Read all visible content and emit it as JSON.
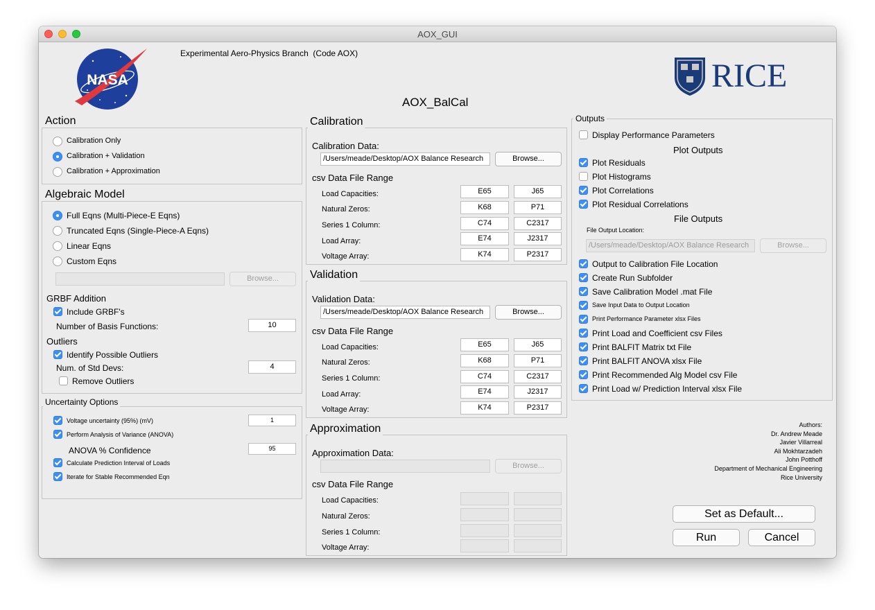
{
  "window": {
    "title": "AOX_GUI"
  },
  "header": {
    "branch": "Experimental Aero-Physics Branch  (Code AOX)",
    "app_name": "AOX_BalCal",
    "nasa_logo_text": "NASA",
    "rice_logo_text": "RICE"
  },
  "action": {
    "title": "Action",
    "options": [
      "Calibration Only",
      "Calibration + Validation",
      "Calibration + Approximation"
    ],
    "selected": "Calibration + Validation"
  },
  "algebraic_model": {
    "title": "Algebraic Model",
    "options": [
      "Full Eqns (Multi-Piece-E Eqns)",
      "Truncated Eqns (Single-Piece-A Eqns)",
      "Linear Eqns",
      "Custom Eqns"
    ],
    "selected": "Full Eqns (Multi-Piece-E Eqns)",
    "custom_path": "",
    "browse_label": "Browse...",
    "grbf": {
      "title": "GRBF Addition",
      "include_label": "Include GRBF's",
      "include_checked": true,
      "basis_label": "Number of Basis Functions:",
      "basis_value": "10"
    },
    "outliers": {
      "title": "Outliers",
      "identify_label": "Identify Possible Outliers",
      "identify_checked": true,
      "std_label": "Num. of Std Devs:",
      "std_value": "4",
      "remove_label": "Remove Outliers",
      "remove_checked": false
    }
  },
  "uncertainty": {
    "title": "Uncertainty Options",
    "voltage_label": "Voltage uncertainty (95%) (mV)",
    "voltage_value": "1",
    "anova_label": "Perform Analysis of Variance (ANOVA)",
    "confidence_label": "ANOVA % Confidence",
    "confidence_value": "95",
    "prediction_label": "Calculate Prediction Interval of Loads",
    "iterate_label": "Iterate for Stable Recommended Eqn"
  },
  "calibration": {
    "title": "Calibration",
    "data_label": "Calibration Data:",
    "data_path": "/Users/meade/Desktop/AOX Balance Research",
    "browse_label": "Browse...",
    "range_title": "csv Data File Range",
    "rows": [
      {
        "label": "Load Capacities:",
        "start": "E65",
        "end": "J65"
      },
      {
        "label": "Natural Zeros:",
        "start": "K68",
        "end": "P71"
      },
      {
        "label": "Series 1 Column:",
        "start": "C74",
        "end": "C2317"
      },
      {
        "label": "Load Array:",
        "start": "E74",
        "end": "J2317"
      },
      {
        "label": "Voltage Array:",
        "start": "K74",
        "end": "P2317"
      }
    ]
  },
  "validation": {
    "title": "Validation",
    "data_label": "Validation Data:",
    "data_path": "/Users/meade/Desktop/AOX Balance Research",
    "browse_label": "Browse...",
    "range_title": "csv Data File Range",
    "rows": [
      {
        "label": "Load Capacities:",
        "start": "E65",
        "end": "J65"
      },
      {
        "label": "Natural Zeros:",
        "start": "K68",
        "end": "P71"
      },
      {
        "label": "Series 1 Column:",
        "start": "C74",
        "end": "C2317"
      },
      {
        "label": "Load Array:",
        "start": "E74",
        "end": "J2317"
      },
      {
        "label": "Voltage Array:",
        "start": "K74",
        "end": "P2317"
      }
    ]
  },
  "approximation": {
    "title": "Approximation",
    "data_label": "Approximation Data:",
    "data_path": "",
    "browse_label": "Browse...",
    "range_title": "csv Data File Range",
    "rows": [
      {
        "label": "Load Capacities:"
      },
      {
        "label": "Natural Zeros:"
      },
      {
        "label": "Series 1 Column:"
      },
      {
        "label": "Voltage Array:"
      }
    ]
  },
  "outputs": {
    "title": "Outputs",
    "display_perf_label": "Display Performance Parameters",
    "display_perf_checked": false,
    "plot_title": "Plot Outputs",
    "plots": [
      {
        "label": "Plot Residuals",
        "checked": true
      },
      {
        "label": "Plot Histograms",
        "checked": false
      },
      {
        "label": "Plot Correlations",
        "checked": true
      },
      {
        "label": "Plot Residual Correlations",
        "checked": true
      }
    ],
    "file_title": "File Outputs",
    "location_label": "File Output Location:",
    "location_path": "/Users/meade/Desktop/AOX Balance Research",
    "browse_label": "Browse...",
    "files": [
      {
        "label": "Output to Calibration File Location",
        "checked": true
      },
      {
        "label": "Create Run Subfolder",
        "checked": true
      },
      {
        "label": "Save Calibration Model .mat File",
        "checked": true
      },
      {
        "label": "Save Input Data to Output Location",
        "checked": true
      },
      {
        "label": "Print Performance Parameter xlsx Files",
        "checked": true
      },
      {
        "label": "Print Load and Coefficient csv Files",
        "checked": true
      },
      {
        "label": "Print BALFIT Matrix txt File",
        "checked": true
      },
      {
        "label": "Print BALFIT ANOVA xlsx File",
        "checked": true
      },
      {
        "label": "Print Recommended Alg Model csv File",
        "checked": true
      },
      {
        "label": "Print Load w/ Prediction Interval xlsx File",
        "checked": true
      }
    ]
  },
  "authors": {
    "heading": "Authors:",
    "lines": [
      "Dr. Andrew Meade",
      "Javier Villarreal",
      "Ali Mokhtarzadeh",
      "John Potthoff",
      "Department of Mechanical Engineering",
      "Rice University"
    ]
  },
  "buttons": {
    "set_default": "Set as Default...",
    "run": "Run",
    "cancel": "Cancel"
  },
  "colors": {
    "accent": "#3d8ef5",
    "nasa_blue": "#1f3f9c",
    "nasa_red": "#e03a3e",
    "rice_blue": "#1a3a78"
  }
}
